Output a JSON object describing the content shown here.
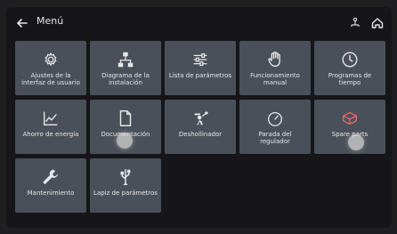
{
  "topbar": {
    "title": "Menú",
    "back_icon": "arrow-left-icon",
    "status_icons": [
      "network-icon",
      "home-icon"
    ]
  },
  "tiles": [
    {
      "label": "Ajustes de la interfaz de usuario",
      "icon": "gear-icon"
    },
    {
      "label": "Diagrama de la instalación",
      "icon": "diagram-icon"
    },
    {
      "label": "Lista de parámetros",
      "icon": "sliders-icon"
    },
    {
      "label": "Funcionamiento manual",
      "icon": "hand-icon"
    },
    {
      "label": "Programas de tiempo",
      "icon": "clock-icon"
    },
    {
      "label": "Ahorro de energía",
      "icon": "chart-line-icon"
    },
    {
      "label": "Documentación",
      "icon": "document-icon"
    },
    {
      "label": "Deshollinador",
      "icon": "chimney-sweep-icon"
    },
    {
      "label": "Parada del regulador",
      "icon": "gauge-icon"
    },
    {
      "label": "Spare parts",
      "icon": "parts-icon"
    },
    {
      "label": "Mantenimiento",
      "icon": "wrench-icon"
    },
    {
      "label": "Lapiz de parámetros",
      "icon": "usb-icon"
    }
  ]
}
